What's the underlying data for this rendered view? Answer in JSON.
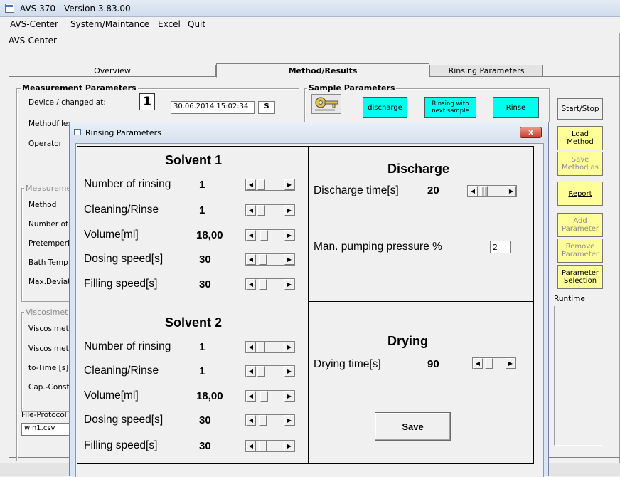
{
  "window": {
    "title": "AVS 370 - Version 3.83.00"
  },
  "menu": {
    "items": [
      "AVS-Center",
      "System/Maintance",
      "Excel",
      "Quit"
    ]
  },
  "center": {
    "title": "AVS-Center"
  },
  "tabs": [
    {
      "label": "Overview"
    },
    {
      "label": "Method/Results"
    },
    {
      "label": "Rinsing Parameters"
    }
  ],
  "measurement": {
    "group_title": "Measurement Parameters",
    "device_label": "Device / changed at:",
    "device_number": "1",
    "date_value": "30.06.2014 15:02:34",
    "s_value": "S",
    "methodfile_label": "Methodfile:",
    "operator_label": "Operator",
    "measurement_group_title": "Measureme",
    "method_label": "Method",
    "number_label": "Number of",
    "pretemp_label": "Pretemperi",
    "bathtemp_label": "Bath Temp",
    "maxdev_label": "Max.Deviat",
    "visco_group_title": "Viscosimet",
    "visco1_label": "Viscosimete",
    "visco2_label": "Viscosimete",
    "totime_label": "to-Time [s]",
    "capconst_label": "Cap.-Const",
    "fileprotocol_label": "File-Protocol",
    "fileprotocol_value": "win1.csv"
  },
  "sample": {
    "group_title": "Sample Parameters",
    "discharge": "discharge",
    "rinsing_next_1": "Rinsing with",
    "rinsing_next_2": "next sample",
    "rinse": "Rinse"
  },
  "right_buttons": {
    "start_stop": "Start/Stop",
    "load_method_1": "Load",
    "load_method_2": "Method",
    "save_method_1": "Save",
    "save_method_2": "Method as",
    "report": "Report",
    "add_param_1": "Add",
    "add_param_2": "Parameter",
    "remove_param_1": "Remove",
    "remove_param_2": "Parameter",
    "param_sel_1": "Parameter",
    "param_sel_2": "Selection",
    "runtime": "Runtime"
  },
  "dialog": {
    "title": "Rinsing Parameters",
    "close": "x",
    "solvent1": {
      "title": "Solvent 1",
      "rows": [
        {
          "label": "Number of rinsing",
          "value": "1"
        },
        {
          "label": "Cleaning/Rinse",
          "value": "1"
        },
        {
          "label": "Volume[ml]",
          "value": "18,00"
        },
        {
          "label": "Dosing speed[s]",
          "value": "30"
        },
        {
          "label": "Filling speed[s]",
          "value": "30"
        }
      ]
    },
    "solvent2": {
      "title": "Solvent 2",
      "rows": [
        {
          "label": "Number of rinsing",
          "value": "1"
        },
        {
          "label": "Cleaning/Rinse",
          "value": "1"
        },
        {
          "label": "Volume[ml]",
          "value": "18,00"
        },
        {
          "label": "Dosing speed[s]",
          "value": "30"
        },
        {
          "label": "Filling speed[s]",
          "value": "30"
        }
      ]
    },
    "discharge": {
      "title": "Discharge",
      "time_label": "Discharge time[s]",
      "time_value": "20",
      "pressure_label": "Man. pumping pressure %",
      "pressure_value": "2"
    },
    "drying": {
      "title": "Drying",
      "time_label": "Drying time[s]",
      "time_value": "90"
    },
    "save": "Save"
  }
}
